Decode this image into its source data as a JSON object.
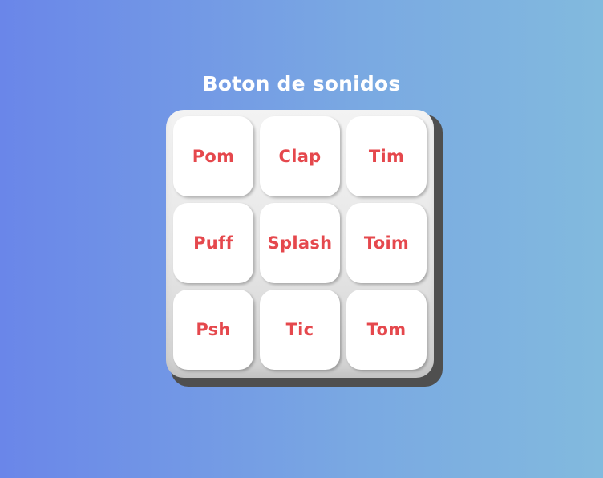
{
  "header": {
    "title": "Boton de sonidos"
  },
  "pad": {
    "keys": [
      {
        "label": "Pom"
      },
      {
        "label": "Clap"
      },
      {
        "label": "Tim"
      },
      {
        "label": "Puff"
      },
      {
        "label": "Splash"
      },
      {
        "label": "Toim"
      },
      {
        "label": "Psh"
      },
      {
        "label": "Tic"
      },
      {
        "label": "Tom"
      }
    ]
  },
  "colors": {
    "key_text": "#e5484d",
    "key_background": "#ffffff",
    "background_start": "#6a86e9",
    "background_end": "#82bade"
  }
}
